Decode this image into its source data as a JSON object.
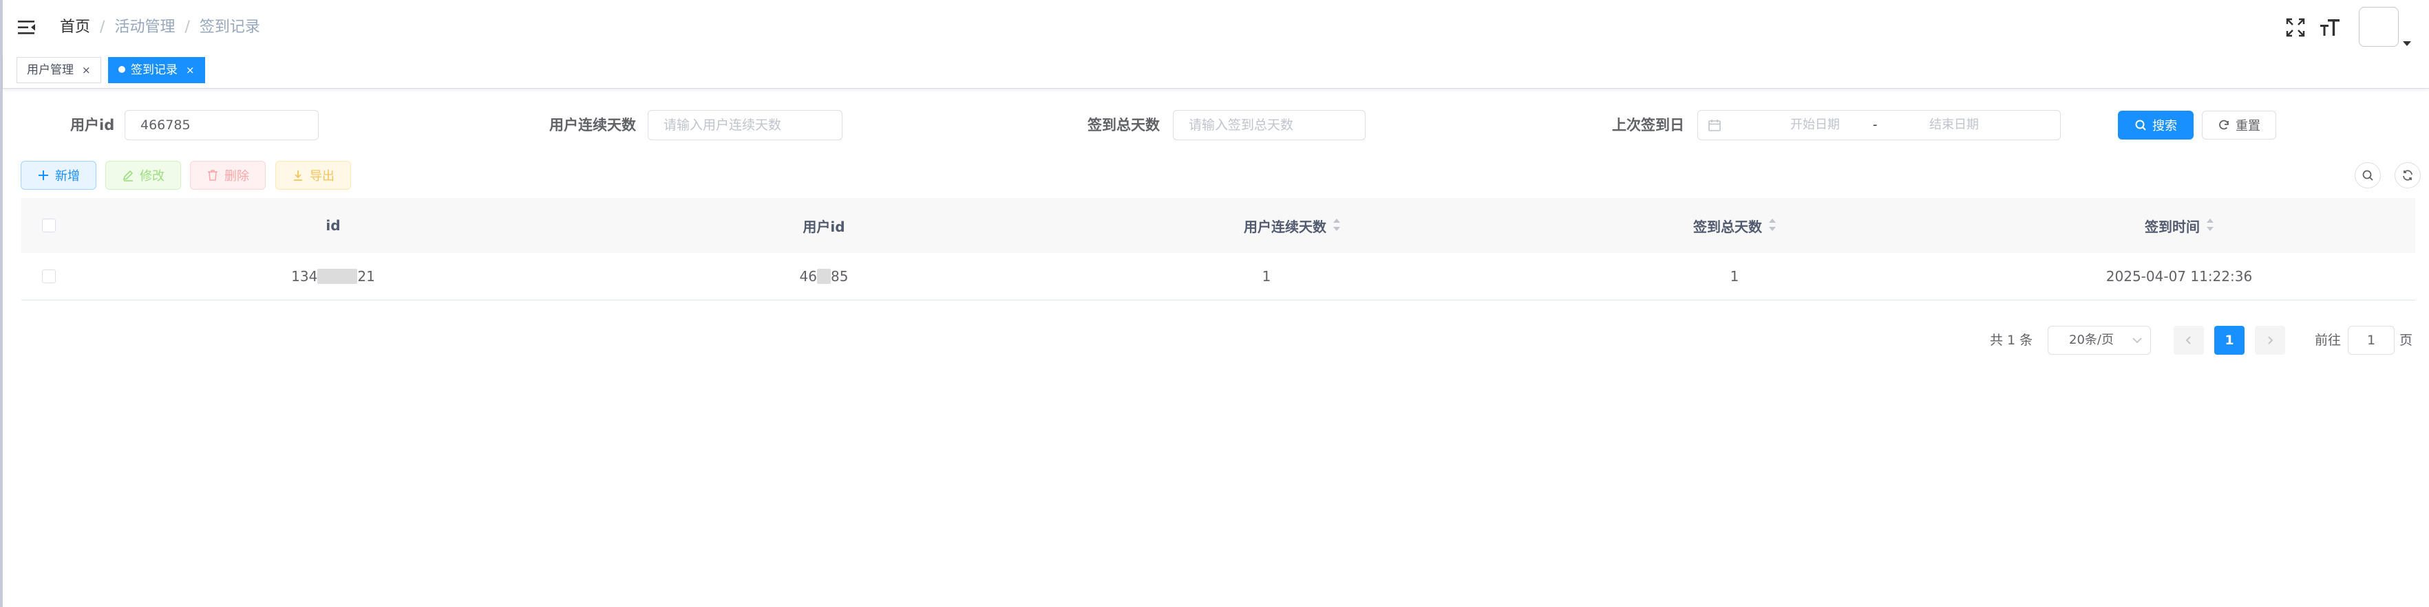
{
  "navbar": {
    "breadcrumb": [
      "首页",
      "活动管理",
      "签到记录"
    ],
    "separator": "/",
    "right_icons": [
      "fullscreen-icon",
      "font-size-icon",
      "avatar-image",
      "caret-down-icon"
    ]
  },
  "tags": [
    {
      "label": "用户管理",
      "close": "×",
      "active": false
    },
    {
      "label": "签到记录",
      "close": "×",
      "active": true
    }
  ],
  "search": {
    "user_id_label": "用户id",
    "user_id_value": "466785",
    "continuous_days_label": "用户连续天数",
    "continuous_days_placeholder": "请输入用户连续天数",
    "total_days_label": "签到总天数",
    "total_days_placeholder": "请输入签到总天数",
    "last_sign_label": "上次签到日",
    "start_date_placeholder": "开始日期",
    "range_separator": "-",
    "end_date_placeholder": "结束日期",
    "search_button": "搜索",
    "reset_button": "重置"
  },
  "toolbar": {
    "add": "新增",
    "edit": "修改",
    "delete": "删除",
    "export": "导出"
  },
  "table": {
    "columns": [
      "id",
      "用户id",
      "用户连续天数",
      "签到总天数",
      "签到时间"
    ],
    "rows": [
      {
        "id_prefix": "134",
        "id_suffix": "21",
        "user_id_prefix": "46",
        "user_id_suffix": "85",
        "continuous_days": "1",
        "total_days": "1",
        "sign_time": "2025-04-07 11:22:36"
      }
    ]
  },
  "pagination": {
    "total_text": "共 1 条",
    "page_size": "20条/页",
    "current_page": "1",
    "goto_label": "前往",
    "goto_value": "1",
    "page_suffix": "页"
  },
  "colors": {
    "primary": "#1890ff",
    "success_plain": "#9adf7e",
    "danger_plain": "#ffa6a6",
    "warning_plain": "#f5c45a"
  }
}
